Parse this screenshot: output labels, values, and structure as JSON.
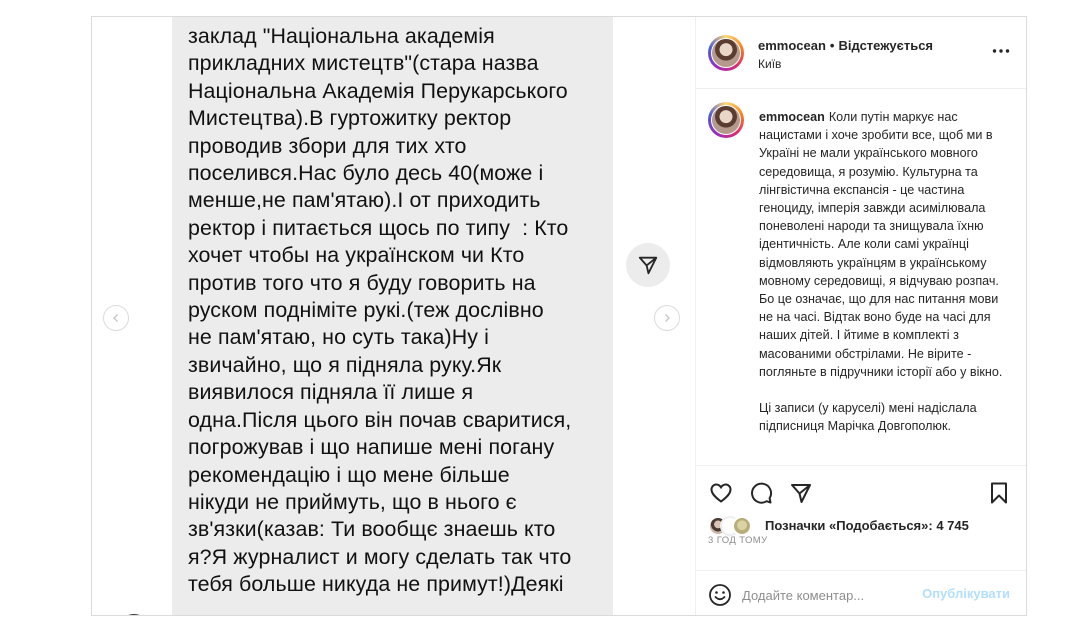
{
  "post": {
    "image_text": "заклад \"Національна академія\nприкладних мистецтв\"(стара назва\nНаціональна Академія Перукарського\nМистецтва).В гуртожитку ректор\nпроводив збори для тих хто\nпоселився.Нас було десь 40(може і\nменше,не пам'ятаю).І от приходить\nректор і питається щось по типу  : Кто\nхочет чтобы на українском чи Кто\nпротив того что я буду говорить на\nруском подніміте рукі.(теж дослівно\nне пам'ятаю, но суть така)Ну і\nзвичайно, що я підняла руку.Як\nвиявилося підняла її лише я\nодна.Після цього він почав сваритися,\nпогрожував і що напише мені погану\nрекомендацію і що мене більше\nнікуди не приймуть, що в нього є\nзв'язки(казав: Ти вообщє знаешь кто\nя?Я журналист и могу сделать так что\nтебя больше никуда не примут!)Деякі"
  },
  "header": {
    "username": "emmocean",
    "separator": "•",
    "follow_status": "Відстежується",
    "location": "Київ",
    "more_icon": "more-horizontal-icon"
  },
  "caption": {
    "username": "emmocean",
    "text": "Коли путін маркує нас нацистами і хоче зробити все, щоб ми в Україні не мали українського мовного середовища, я розумію. Культурна та лінгвістична експансія - це частина геноциду, імперія завжди асимілювала поневолені народи та знищувала їхню ідентичність. Але коли самі українці відмовляють українцям в українському мовному середовищі, я відчуваю розпач. Бо це означає, що для нас питання мови не на часі. Відтак воно буде на часі для наших дітей. І йтиме в комплекті з масованими обстрілами. Не вірите - погляньте в підручники історії або у вікно.\n\nЦі записи (у каруселі) мені надіслала підписниця Марічка Довгополюк."
  },
  "actions": {
    "icons": [
      "heart-icon",
      "comment-icon",
      "share-icon",
      "bookmark-icon"
    ]
  },
  "likes": {
    "label": "Позначки «Подобається»:",
    "count": "4 745"
  },
  "timestamp": "3 ГОД ТОМУ",
  "comment": {
    "placeholder": "Додайте коментар...",
    "publish_label": "Опублікувати"
  },
  "colors": {
    "accent_disabled": "#b2dffc",
    "text": "#262626",
    "muted": "#8e8e8e",
    "message_bg": "#ececec"
  }
}
